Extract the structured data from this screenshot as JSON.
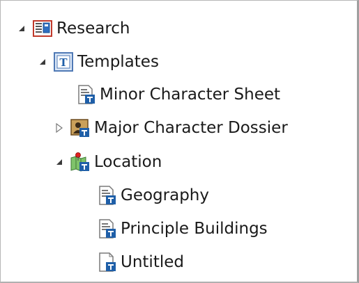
{
  "binder": {
    "items": [
      {
        "label": "Research",
        "icon": "research-folder-icon",
        "expanded": true
      },
      {
        "label": "Templates",
        "icon": "templates-folder-icon",
        "expanded": true
      },
      {
        "label": "Minor Character Sheet",
        "icon": "template-document-icon"
      },
      {
        "label": "Major Character Dossier",
        "icon": "character-photo-template-icon",
        "expanded": false
      },
      {
        "label": "Location",
        "icon": "location-map-template-icon",
        "expanded": true
      },
      {
        "label": "Geography",
        "icon": "template-document-icon"
      },
      {
        "label": "Principle Buildings",
        "icon": "template-document-icon"
      },
      {
        "label": "Untitled",
        "icon": "blank-template-document-icon"
      }
    ]
  },
  "colors": {
    "text": "#1a1a1a",
    "template_badge": "#1f5fa8",
    "research_icon_border": "#c0392b",
    "location_pin": "#e02020"
  }
}
